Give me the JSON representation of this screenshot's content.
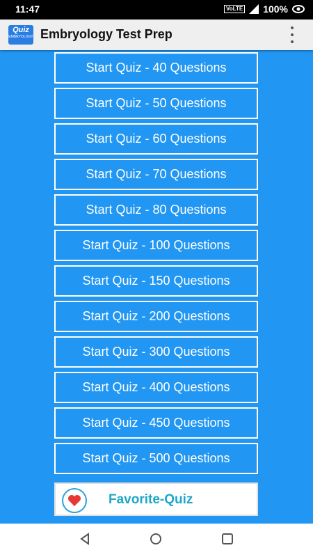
{
  "status": {
    "time": "11:47",
    "volte": "VoLTE",
    "battery": "100%"
  },
  "appbar": {
    "logo_text": "Quiz",
    "logo_subtext": "EMBRYOLOGY",
    "title": "Embryology Test Prep"
  },
  "quizzes": [
    "Start Quiz - 40 Questions",
    "Start Quiz - 50 Questions",
    "Start Quiz - 60 Questions",
    "Start Quiz - 70 Questions",
    "Start Quiz - 80 Questions",
    "Start Quiz - 100 Questions",
    "Start Quiz - 150 Questions",
    "Start Quiz - 200 Questions",
    "Start Quiz - 300 Questions",
    "Start Quiz - 400 Questions",
    "Start Quiz - 450 Questions",
    "Start Quiz - 500 Questions"
  ],
  "favorite": {
    "label": "Favorite-Quiz",
    "icon": "heart-icon"
  },
  "colors": {
    "background": "#2196F3",
    "accent": "#1ea7c7",
    "heart": "#e53935"
  },
  "nav": {
    "back": "back-icon",
    "home": "home-icon",
    "recents": "recents-icon"
  }
}
